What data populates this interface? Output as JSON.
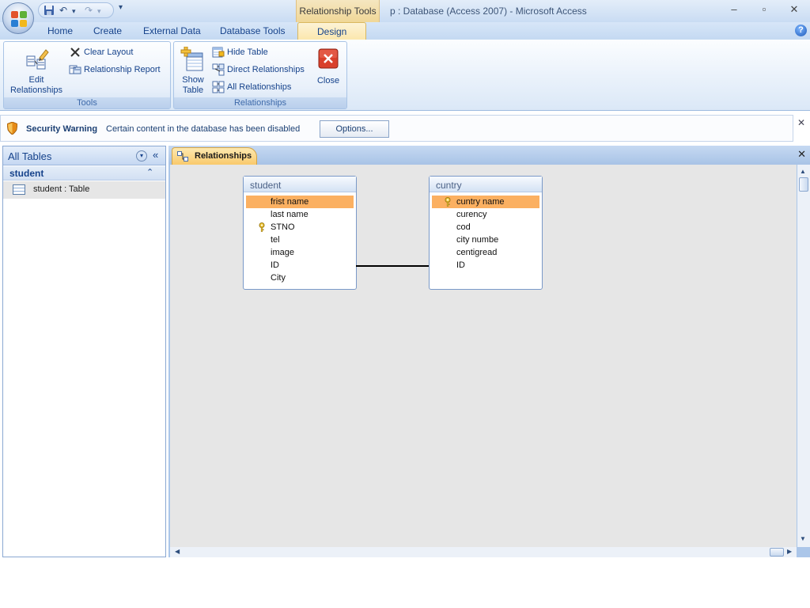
{
  "titlebar": {
    "contextual_tools": "Relationship Tools",
    "window_title": "p : Database (Access 2007)  -  Microsoft Access",
    "minimize": "–",
    "restore": "▫",
    "close": "✕"
  },
  "tabs": [
    "Home",
    "Create",
    "External Data",
    "Database Tools",
    "Design"
  ],
  "help": "?",
  "ribbon": {
    "tools": {
      "label": "Tools",
      "edit_relationships_line1": "Edit",
      "edit_relationships_line2": "Relationships",
      "clear_layout": "Clear Layout",
      "relationship_report": "Relationship Report"
    },
    "relationships": {
      "label": "Relationships",
      "show_table_line1": "Show",
      "show_table_line2": "Table",
      "hide_table": "Hide Table",
      "direct_relationships": "Direct Relationships",
      "all_relationships": "All Relationships",
      "close": "Close"
    }
  },
  "security_bar": {
    "title": "Security Warning",
    "message": "Certain content in the database has been disabled",
    "options_button": "Options...",
    "close": "✕"
  },
  "nav_pane": {
    "title": "All Tables",
    "dropdown": "▾",
    "collapse": "«",
    "group_label": "student",
    "group_toggle": "⌃",
    "items": [
      {
        "label": "student : Table"
      }
    ]
  },
  "document": {
    "tab_label": "Relationships",
    "close": "✕"
  },
  "tables": [
    {
      "name": "student",
      "fields": [
        {
          "name": "frist name",
          "key": false,
          "selected": true
        },
        {
          "name": "last name",
          "key": false,
          "selected": false
        },
        {
          "name": "STNO",
          "key": true,
          "selected": false
        },
        {
          "name": "tel",
          "key": false,
          "selected": false
        },
        {
          "name": "image",
          "key": false,
          "selected": false
        },
        {
          "name": "ID",
          "key": false,
          "selected": false
        },
        {
          "name": "City",
          "key": false,
          "selected": false
        }
      ]
    },
    {
      "name": "cuntry",
      "fields": [
        {
          "name": "cuntry name",
          "key": true,
          "selected": true
        },
        {
          "name": "curency",
          "key": false,
          "selected": false
        },
        {
          "name": "cod",
          "key": false,
          "selected": false
        },
        {
          "name": "city numbe",
          "key": false,
          "selected": false
        },
        {
          "name": "centigread",
          "key": false,
          "selected": false
        },
        {
          "name": "ID",
          "key": false,
          "selected": false
        }
      ]
    }
  ],
  "colors": {
    "selected_field": "#fbb061",
    "canvas": "#e6e6e6",
    "accent_tab": "#f9c96b"
  }
}
